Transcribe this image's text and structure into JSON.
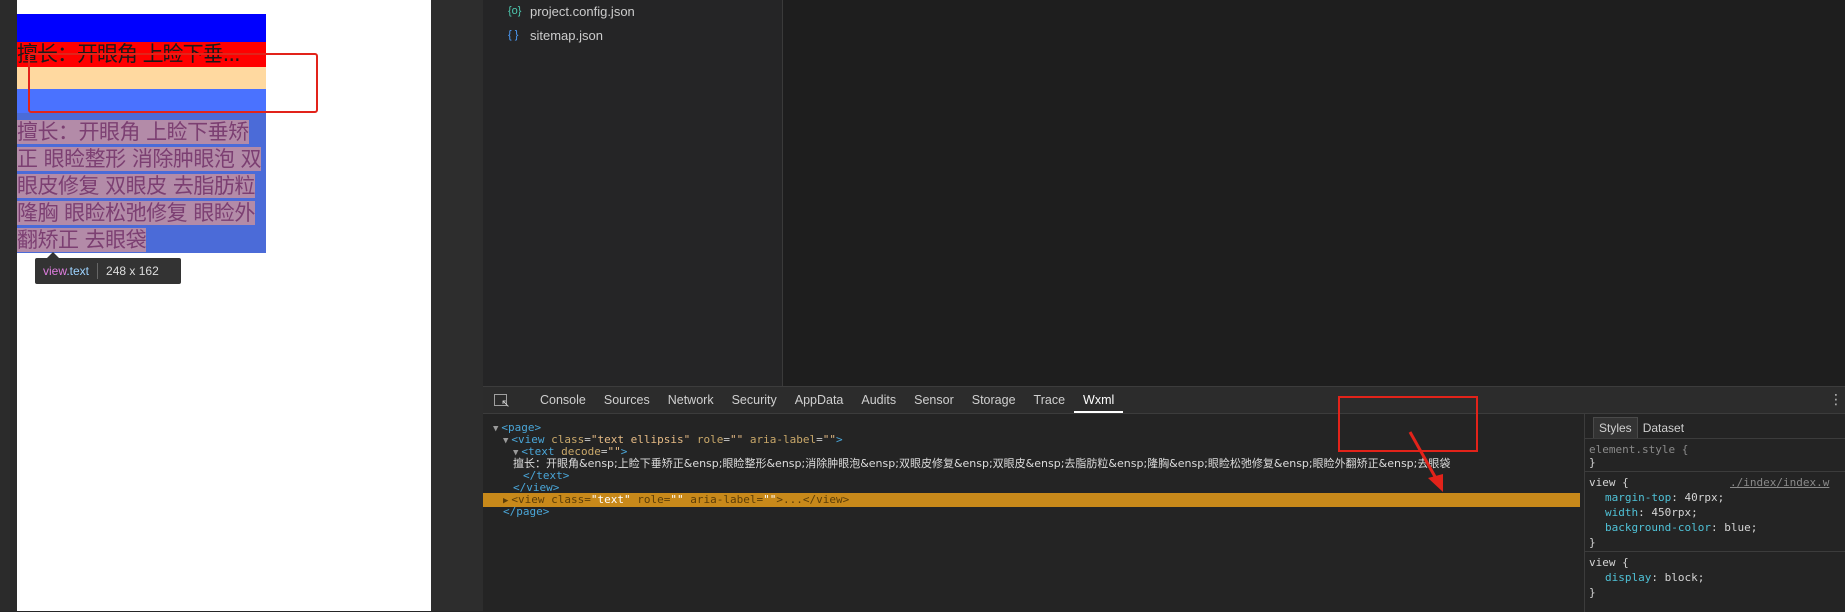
{
  "simulator": {
    "ellipsis_text": "擅长：开眼角 上睑下垂...",
    "full_text": "擅长：开眼角  上睑下垂矫正  眼睑整形  消除肿眼泡  双眼皮修复  双眼皮  去脂肪粒  隆胸  眼睑松弛修复  眼睑外翻矫正  去眼袋",
    "tooltip_selector_tag": "view",
    "tooltip_selector_class": ".text",
    "tooltip_size": "248 x 162"
  },
  "filetree": {
    "items": [
      {
        "icon": "{o}",
        "label": "project.config.json"
      },
      {
        "icon": "{ }",
        "label": "sitemap.json"
      }
    ]
  },
  "devtools": {
    "tabs": [
      "Console",
      "Sources",
      "Network",
      "Security",
      "AppData",
      "Audits",
      "Sensor",
      "Storage",
      "Trace",
      "Wxml"
    ],
    "active_tab": "Wxml",
    "tree": {
      "page_open": "<page>",
      "view1_tag": "<view",
      "view1_class_attr": "class",
      "view1_class_val": "\"text ellipsis\"",
      "view1_role_attr": "role",
      "view1_role_val": "\"\"",
      "view1_aria_attr": "aria-label",
      "view1_aria_val": "\"\"",
      "text_tag": "<text",
      "text_decode_attr": "decode",
      "text_decode_val": "\"\"",
      "text_content": "擅长：开眼角&ensp;上睑下垂矫正&ensp;眼睑整形&ensp;消除肿眼泡&ensp;双眼皮修复&ensp;双眼皮&ensp;去脂肪粒&ensp;隆胸&ensp;眼睑松弛修复&ensp;眼睑外翻矫正&ensp;去眼袋",
      "text_close": "</text>",
      "view_close": "</view>",
      "view2_tag": "<view",
      "view2_class_attr": "class",
      "view2_class_val": "\"text\"",
      "view2_role_attr": "role",
      "view2_role_val": "\"\"",
      "view2_aria_attr": "aria-label",
      "view2_aria_val": "\"\"",
      "view2_rest": ">...</view>",
      "page_close": "</page>"
    },
    "styles": {
      "tabs": [
        "Styles",
        "Dataset"
      ],
      "active_tab": "Styles",
      "element_style": "element.style {",
      "close_brace": "}",
      "rule1_selector": "view {",
      "rule1_source": "./index/index.w",
      "rule1_props": [
        {
          "name": "margin-top",
          "value": "40rpx;"
        },
        {
          "name": "width",
          "value": "450rpx;"
        },
        {
          "name": "background-color",
          "value": "blue;"
        }
      ],
      "rule2_selector": "view {",
      "rule2_props": [
        {
          "name": "display",
          "value": "block;"
        }
      ]
    }
  },
  "colors": {
    "highlight_row": "#c8891a",
    "annotation_red": "#e2231a"
  }
}
